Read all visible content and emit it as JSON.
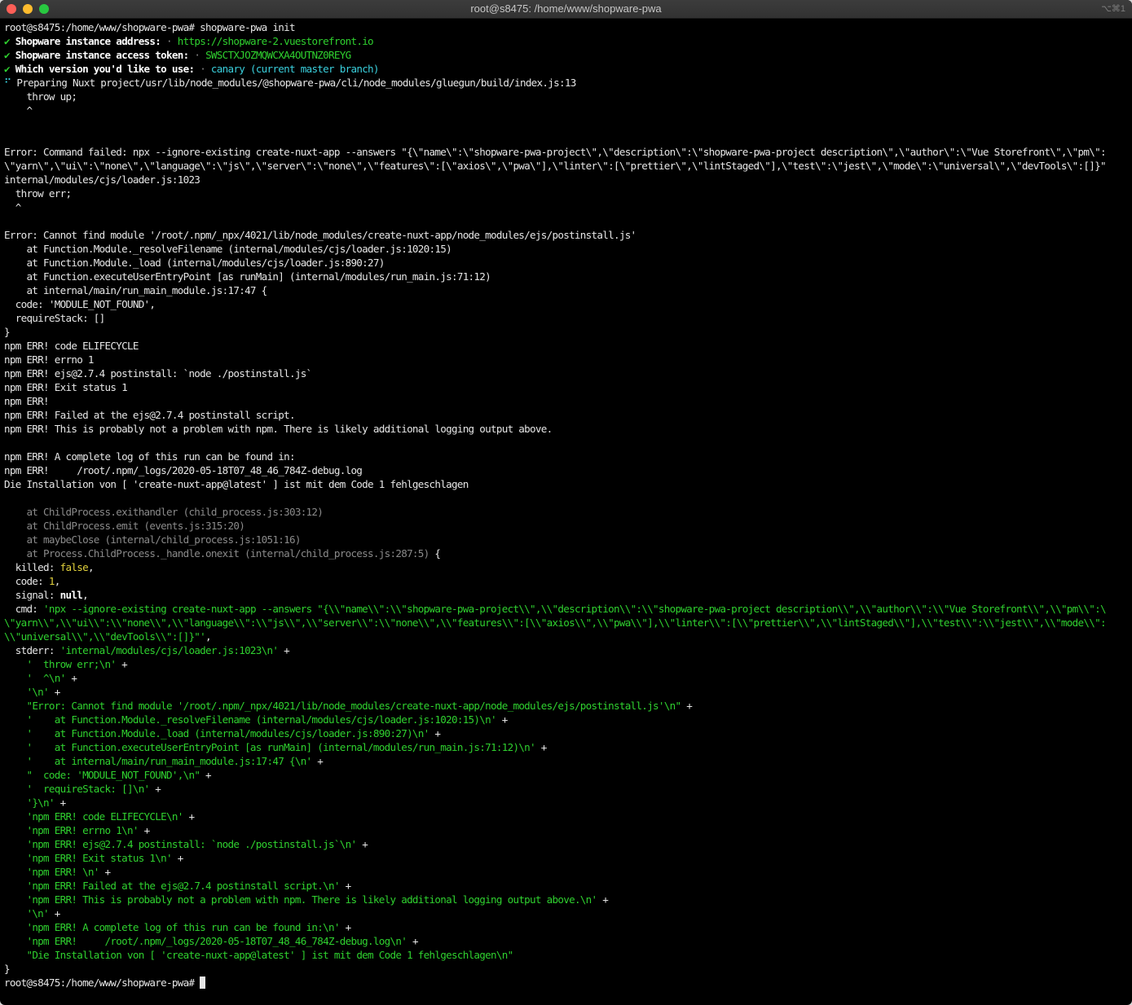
{
  "window": {
    "title": "root@s8475: /home/www/shopware-pwa",
    "shortcut": "⌥⌘1"
  },
  "terminal": {
    "lines": [
      [
        {
          "t": "root@s8475:/home/www/shopware-pwa# shopware-pwa init"
        }
      ],
      [
        {
          "t": "✔ ",
          "s": "g"
        },
        {
          "t": "Shopware instance address:",
          "s": "b"
        },
        {
          "t": " · ",
          "s": "dim"
        },
        {
          "t": "https://shopware-2.vuestorefront.io",
          "s": "g"
        }
      ],
      [
        {
          "t": "✔ ",
          "s": "g"
        },
        {
          "t": "Shopware instance access token:",
          "s": "b"
        },
        {
          "t": " · ",
          "s": "dim"
        },
        {
          "t": "SWSCTXJOZMQWCXA4OUTNZ0REYG",
          "s": "g"
        }
      ],
      [
        {
          "t": "✔ ",
          "s": "g"
        },
        {
          "t": "Which version you'd like to use:",
          "s": "b"
        },
        {
          "t": " · ",
          "s": "dim"
        },
        {
          "t": "canary (current master branch)",
          "s": "c"
        }
      ],
      [
        {
          "t": "⠋ ",
          "s": "c"
        },
        {
          "t": "Preparing Nuxt project/usr/lib/node_modules/@shopware-pwa/cli/node_modules/gluegun/build/index.js:13"
        }
      ],
      [
        {
          "t": "    throw up;"
        }
      ],
      [
        {
          "t": "    ^"
        }
      ],
      [
        {
          "t": ""
        }
      ],
      [
        {
          "t": ""
        }
      ],
      [
        {
          "t": "Error: Command failed: npx --ignore-existing create-nuxt-app --answers \"{\\\"name\\\":\\\"shopware-pwa-project\\\",\\\"description\\\":\\\"shopware-pwa-project description\\\",\\\"author\\\":\\\"Vue Storefront\\\",\\\"pm\\\":"
        }
      ],
      [
        {
          "t": "\\\"yarn\\\",\\\"ui\\\":\\\"none\\\",\\\"language\\\":\\\"js\\\",\\\"server\\\":\\\"none\\\",\\\"features\\\":[\\\"axios\\\",\\\"pwa\\\"],\\\"linter\\\":[\\\"prettier\\\",\\\"lintStaged\\\"],\\\"test\\\":\\\"jest\\\",\\\"mode\\\":\\\"universal\\\",\\\"devTools\\\":[]}\""
        }
      ],
      [
        {
          "t": "internal/modules/cjs/loader.js:1023"
        }
      ],
      [
        {
          "t": "  throw err;"
        }
      ],
      [
        {
          "t": "  ^"
        }
      ],
      [
        {
          "t": ""
        }
      ],
      [
        {
          "t": "Error: Cannot find module '/root/.npm/_npx/4021/lib/node_modules/create-nuxt-app/node_modules/ejs/postinstall.js'"
        }
      ],
      [
        {
          "t": "    at Function.Module._resolveFilename (internal/modules/cjs/loader.js:1020:15)"
        }
      ],
      [
        {
          "t": "    at Function.Module._load (internal/modules/cjs/loader.js:890:27)"
        }
      ],
      [
        {
          "t": "    at Function.executeUserEntryPoint [as runMain] (internal/modules/run_main.js:71:12)"
        }
      ],
      [
        {
          "t": "    at internal/main/run_main_module.js:17:47 {"
        }
      ],
      [
        {
          "t": "  code: 'MODULE_NOT_FOUND',"
        }
      ],
      [
        {
          "t": "  requireStack: []"
        }
      ],
      [
        {
          "t": "}"
        }
      ],
      [
        {
          "t": "npm ERR! code ELIFECYCLE"
        }
      ],
      [
        {
          "t": "npm ERR! errno 1"
        }
      ],
      [
        {
          "t": "npm ERR! ejs@2.7.4 postinstall: `node ./postinstall.js`"
        }
      ],
      [
        {
          "t": "npm ERR! Exit status 1"
        }
      ],
      [
        {
          "t": "npm ERR!"
        }
      ],
      [
        {
          "t": "npm ERR! Failed at the ejs@2.7.4 postinstall script."
        }
      ],
      [
        {
          "t": "npm ERR! This is probably not a problem with npm. There is likely additional logging output above."
        }
      ],
      [
        {
          "t": ""
        }
      ],
      [
        {
          "t": "npm ERR! A complete log of this run can be found in:"
        }
      ],
      [
        {
          "t": "npm ERR!     /root/.npm/_logs/2020-05-18T07_48_46_784Z-debug.log"
        }
      ],
      [
        {
          "t": "Die Installation von [ 'create-nuxt-app@latest' ] ist mit dem Code 1 fehlgeschlagen"
        }
      ],
      [
        {
          "t": ""
        }
      ],
      [
        {
          "t": "    at ChildProcess.exithandler (child_process.js:303:12)",
          "s": "dim"
        }
      ],
      [
        {
          "t": "    at ChildProcess.emit (events.js:315:20)",
          "s": "dim"
        }
      ],
      [
        {
          "t": "    at maybeClose (internal/child_process.js:1051:16)",
          "s": "dim"
        }
      ],
      [
        {
          "t": "    at Process.ChildProcess._handle.onexit (internal/child_process.js:287:5)",
          "s": "dim"
        },
        {
          "t": " {"
        }
      ],
      [
        {
          "t": "  killed: "
        },
        {
          "t": "false",
          "s": "y"
        },
        {
          "t": ","
        }
      ],
      [
        {
          "t": "  code: "
        },
        {
          "t": "1",
          "s": "y"
        },
        {
          "t": ","
        }
      ],
      [
        {
          "t": "  signal: "
        },
        {
          "t": "null",
          "s": "b"
        },
        {
          "t": ","
        }
      ],
      [
        {
          "t": "  cmd: "
        },
        {
          "t": "'npx --ignore-existing create-nuxt-app --answers \"{\\\\\"name\\\\\":\\\\\"shopware-pwa-project\\\\\",\\\\\"description\\\\\":\\\\\"shopware-pwa-project description\\\\\",\\\\\"author\\\\\":\\\\\"Vue Storefront\\\\\",\\\\\"pm\\\\\":\\",
          "s": "g"
        }
      ],
      [
        {
          "t": "\\\"yarn\\\\\",\\\\\"ui\\\\\":\\\\\"none\\\\\",\\\\\"language\\\\\":\\\\\"js\\\\\",\\\\\"server\\\\\":\\\\\"none\\\\\",\\\\\"features\\\\\":[\\\\\"axios\\\\\",\\\\\"pwa\\\\\"],\\\\\"linter\\\\\":[\\\\\"prettier\\\\\",\\\\\"lintStaged\\\\\"],\\\\\"test\\\\\":\\\\\"jest\\\\\",\\\\\"mode\\\\\":",
          "s": "g"
        }
      ],
      [
        {
          "t": "\\\\\"universal\\\\\",\\\\\"devTools\\\\\":[]}\"'",
          "s": "g"
        },
        {
          "t": ","
        }
      ],
      [
        {
          "t": "  stderr: "
        },
        {
          "t": "'internal/modules/cjs/loader.js:1023\\n'",
          "s": "g"
        },
        {
          "t": " +"
        }
      ],
      [
        {
          "t": "    "
        },
        {
          "t": "'  throw err;\\n'",
          "s": "g"
        },
        {
          "t": " +"
        }
      ],
      [
        {
          "t": "    "
        },
        {
          "t": "'  ^\\n'",
          "s": "g"
        },
        {
          "t": " +"
        }
      ],
      [
        {
          "t": "    "
        },
        {
          "t": "'\\n'",
          "s": "g"
        },
        {
          "t": " +"
        }
      ],
      [
        {
          "t": "    "
        },
        {
          "t": "\"Error: Cannot find module '/root/.npm/_npx/4021/lib/node_modules/create-nuxt-app/node_modules/ejs/postinstall.js'\\n\"",
          "s": "g"
        },
        {
          "t": " +"
        }
      ],
      [
        {
          "t": "    "
        },
        {
          "t": "'    at Function.Module._resolveFilename (internal/modules/cjs/loader.js:1020:15)\\n'",
          "s": "g"
        },
        {
          "t": " +"
        }
      ],
      [
        {
          "t": "    "
        },
        {
          "t": "'    at Function.Module._load (internal/modules/cjs/loader.js:890:27)\\n'",
          "s": "g"
        },
        {
          "t": " +"
        }
      ],
      [
        {
          "t": "    "
        },
        {
          "t": "'    at Function.executeUserEntryPoint [as runMain] (internal/modules/run_main.js:71:12)\\n'",
          "s": "g"
        },
        {
          "t": " +"
        }
      ],
      [
        {
          "t": "    "
        },
        {
          "t": "'    at internal/main/run_main_module.js:17:47 {\\n'",
          "s": "g"
        },
        {
          "t": " +"
        }
      ],
      [
        {
          "t": "    "
        },
        {
          "t": "\"  code: 'MODULE_NOT_FOUND',\\n\"",
          "s": "g"
        },
        {
          "t": " +"
        }
      ],
      [
        {
          "t": "    "
        },
        {
          "t": "'  requireStack: []\\n'",
          "s": "g"
        },
        {
          "t": " +"
        }
      ],
      [
        {
          "t": "    "
        },
        {
          "t": "'}\\n'",
          "s": "g"
        },
        {
          "t": " +"
        }
      ],
      [
        {
          "t": "    "
        },
        {
          "t": "'npm ERR! code ELIFECYCLE\\n'",
          "s": "g"
        },
        {
          "t": " +"
        }
      ],
      [
        {
          "t": "    "
        },
        {
          "t": "'npm ERR! errno 1\\n'",
          "s": "g"
        },
        {
          "t": " +"
        }
      ],
      [
        {
          "t": "    "
        },
        {
          "t": "'npm ERR! ejs@2.7.4 postinstall: `node ./postinstall.js`\\n'",
          "s": "g"
        },
        {
          "t": " +"
        }
      ],
      [
        {
          "t": "    "
        },
        {
          "t": "'npm ERR! Exit status 1\\n'",
          "s": "g"
        },
        {
          "t": " +"
        }
      ],
      [
        {
          "t": "    "
        },
        {
          "t": "'npm ERR! \\n'",
          "s": "g"
        },
        {
          "t": " +"
        }
      ],
      [
        {
          "t": "    "
        },
        {
          "t": "'npm ERR! Failed at the ejs@2.7.4 postinstall script.\\n'",
          "s": "g"
        },
        {
          "t": " +"
        }
      ],
      [
        {
          "t": "    "
        },
        {
          "t": "'npm ERR! This is probably not a problem with npm. There is likely additional logging output above.\\n'",
          "s": "g"
        },
        {
          "t": " +"
        }
      ],
      [
        {
          "t": "    "
        },
        {
          "t": "'\\n'",
          "s": "g"
        },
        {
          "t": " +"
        }
      ],
      [
        {
          "t": "    "
        },
        {
          "t": "'npm ERR! A complete log of this run can be found in:\\n'",
          "s": "g"
        },
        {
          "t": " +"
        }
      ],
      [
        {
          "t": "    "
        },
        {
          "t": "'npm ERR!     /root/.npm/_logs/2020-05-18T07_48_46_784Z-debug.log\\n'",
          "s": "g"
        },
        {
          "t": " +"
        }
      ],
      [
        {
          "t": "    "
        },
        {
          "t": "\"Die Installation von [ 'create-nuxt-app@latest' ] ist mit dem Code 1 fehlgeschlagen\\n\"",
          "s": "g"
        }
      ],
      [
        {
          "t": "}"
        }
      ]
    ],
    "prompt": "root@s8475:/home/www/shopware-pwa# "
  }
}
